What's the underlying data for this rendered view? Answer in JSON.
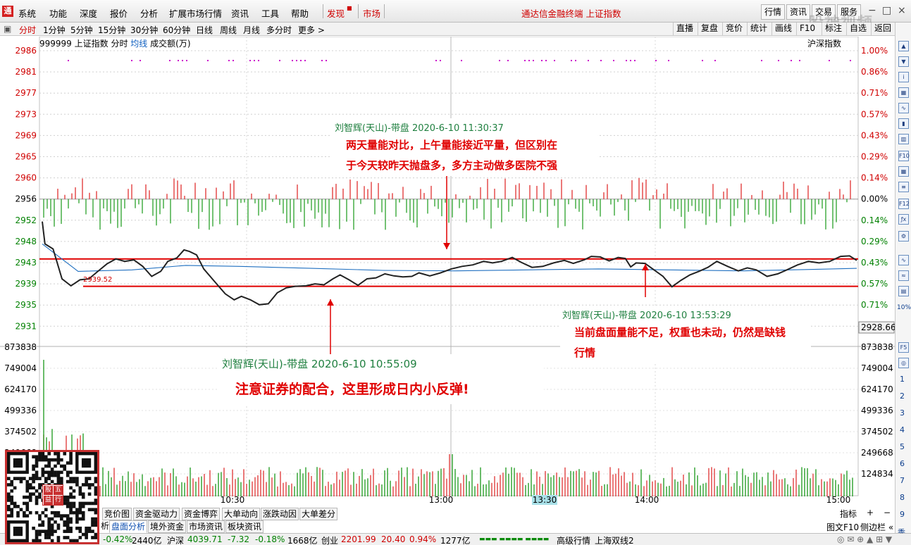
{
  "menubar": {
    "logo_glyph": "通",
    "items": [
      "系统",
      "功能",
      "深度",
      "报价",
      "分析",
      "扩展市场行情",
      "资讯",
      "工具",
      "帮助"
    ],
    "discover": "发现",
    "market": "市场",
    "title": "通达信金融终端 上证指数",
    "right_buttons": [
      "行情",
      "资讯",
      "交易",
      "服务"
    ],
    "window_controls": [
      "−",
      "□",
      "×"
    ]
  },
  "toolbar": {
    "periods": [
      "分时",
      "1分钟",
      "5分钟",
      "15分钟",
      "30分钟",
      "60分钟",
      "日线",
      "周线",
      "月线",
      "多分时",
      "更多 >"
    ],
    "active_period": "分时",
    "right": [
      "直播",
      "复盘",
      "竞价",
      "统计",
      "画线",
      "F10",
      "标注",
      "自选",
      "返回"
    ]
  },
  "chart_info": {
    "code": "999999 上证指数",
    "mode": "分时",
    "avg_line": "均线",
    "volume_label": "成交额(万)",
    "right_label": "沪深指数"
  },
  "watermark": "股神视频",
  "chart_data": {
    "type": "line",
    "title": "999999 上证指数 分时",
    "price_axis_left": [
      "2986",
      "2981",
      "2977",
      "2973",
      "2969",
      "2965",
      "2960",
      "2956",
      "2952",
      "2948",
      "2943",
      "2939",
      "2935",
      "2931"
    ],
    "pct_axis_right": [
      "1.00%",
      "0.86%",
      "0.71%",
      "0.57%",
      "0.43%",
      "0.29%",
      "0.14%",
      "0.00%",
      "0.14%",
      "0.29%",
      "0.43%",
      "0.57%",
      "0.71%",
      "0.86%"
    ],
    "prev_close": 2956,
    "current_price_label": "2928.66",
    "low_label": "2939.52",
    "volume_axis": [
      "873838",
      "749004",
      "624170",
      "499336",
      "374502",
      "249668",
      "124834"
    ],
    "time_labels": [
      "10:30",
      "13:00",
      "13:30",
      "14:00",
      "15:00"
    ],
    "highlighted_time": "13:30",
    "support_resistance": [
      2944,
      2938.5
    ],
    "price_path": [
      [
        0,
        2951.5
      ],
      [
        3,
        2947
      ],
      [
        12,
        2946
      ],
      [
        22,
        2940
      ],
      [
        32,
        2938.6
      ],
      [
        42,
        2939.8
      ],
      [
        52,
        2940
      ],
      [
        62,
        2941.5
      ],
      [
        72,
        2943
      ],
      [
        82,
        2944
      ],
      [
        92,
        2943.5
      ],
      [
        102,
        2943.8
      ],
      [
        112,
        2942.5
      ],
      [
        122,
        2940.5
      ],
      [
        132,
        2941.5
      ],
      [
        140,
        2943.5
      ],
      [
        150,
        2944.2
      ],
      [
        158,
        2945.8
      ],
      [
        164,
        2945.5
      ],
      [
        172,
        2944.8
      ],
      [
        180,
        2942
      ],
      [
        192,
        2939.5
      ],
      [
        204,
        2937
      ],
      [
        214,
        2935.8
      ],
      [
        222,
        2936.5
      ],
      [
        232,
        2935.8
      ],
      [
        242,
        2934.8
      ],
      [
        252,
        2935
      ],
      [
        262,
        2937.2
      ],
      [
        272,
        2938.2
      ],
      [
        282,
        2938.5
      ],
      [
        294,
        2938.6
      ],
      [
        304,
        2939
      ],
      [
        314,
        2938.8
      ],
      [
        324,
        2940
      ],
      [
        332,
        2940.8
      ],
      [
        342,
        2939.8
      ],
      [
        352,
        2938.7
      ],
      [
        362,
        2940
      ],
      [
        372,
        2940.2
      ],
      [
        382,
        2941
      ],
      [
        392,
        2940.6
      ],
      [
        402,
        2940.4
      ],
      [
        412,
        2940.5
      ],
      [
        420,
        2941.2
      ],
      [
        432,
        2940.6
      ],
      [
        444,
        2941.2
      ],
      [
        456,
        2942
      ],
      [
        468,
        2942.5
      ],
      [
        480,
        2942.8
      ],
      [
        492,
        2943.5
      ],
      [
        502,
        2943.2
      ],
      [
        512,
        2943.5
      ],
      [
        524,
        2944.3
      ],
      [
        534,
        2943.3
      ],
      [
        546,
        2942.3
      ],
      [
        558,
        2942.5
      ],
      [
        570,
        2943.2
      ],
      [
        582,
        2943.7
      ],
      [
        592,
        2943.1
      ],
      [
        604,
        2943.8
      ],
      [
        612,
        2944.5
      ],
      [
        622,
        2944.4
      ],
      [
        632,
        2943.6
      ],
      [
        642,
        2944.3
      ],
      [
        650,
        2944.1
      ],
      [
        656,
        2942.4
      ],
      [
        662,
        2943.2
      ],
      [
        672,
        2943.1
      ],
      [
        682,
        2941.8
      ],
      [
        692,
        2940.5
      ],
      [
        702,
        2938.4
      ],
      [
        712,
        2939.7
      ],
      [
        722,
        2940.8
      ],
      [
        732,
        2941.5
      ],
      [
        742,
        2942.3
      ],
      [
        752,
        2943.5
      ],
      [
        764,
        2942.5
      ],
      [
        776,
        2941.6
      ],
      [
        786,
        2942.2
      ],
      [
        796,
        2941.8
      ],
      [
        808,
        2940.5
      ],
      [
        820,
        2941
      ],
      [
        830,
        2941.8
      ],
      [
        842,
        2942.8
      ],
      [
        854,
        2943.5
      ],
      [
        866,
        2943.2
      ],
      [
        878,
        2943.5
      ],
      [
        890,
        2944.5
      ],
      [
        900,
        2944.6
      ],
      [
        908,
        2943.7
      ]
    ],
    "avg_path": [
      [
        0,
        2947
      ],
      [
        40,
        2941.5
      ],
      [
        100,
        2941.8
      ],
      [
        160,
        2942.7
      ],
      [
        220,
        2942.5
      ],
      [
        300,
        2942.1
      ],
      [
        380,
        2941.7
      ],
      [
        460,
        2941.6
      ],
      [
        540,
        2941.8
      ],
      [
        620,
        2942
      ],
      [
        700,
        2941.8
      ],
      [
        780,
        2941.6
      ],
      [
        860,
        2941.9
      ],
      [
        908,
        2942.1
      ]
    ]
  },
  "notes": [
    {
      "meta": "刘智辉(天山)-带盘 2020-6-10 11:30:37",
      "lines": [
        "两天量能对比，上午量能接近平量，但区别在",
        "于今天较昨天抛盘多，多方主动做多医院不强"
      ]
    },
    {
      "meta": "刘智辉(天山)-带盘 2020-6-10 10:55:09",
      "lines": [
        "注意证券的配合，这里形成日内小反弹!"
      ]
    },
    {
      "meta": "刘智辉(天山)-带盘 2020-6-10 13:53:29",
      "lines": [
        "当前盘面量能不足，权重也未动，仍然是缺钱",
        "行情"
      ]
    }
  ],
  "bottom_tabs_row1": [
    "竞价图",
    "资金驱动力",
    "资金博弈",
    "大单动向",
    "涨跌动因",
    "大单差分"
  ],
  "bottom_tabs_row2": [
    "析",
    "盘面分析",
    "境外资金",
    "市场资讯",
    "板块资讯"
  ],
  "bottom_right": [
    "指标",
    "+",
    "−"
  ],
  "bottom_right2": [
    "图文F10",
    "侧边栏 «"
  ],
  "qr_tiles": [
    "股",
    "五",
    "益",
    "行"
  ],
  "rightbar_numbers": [
    "1",
    "2",
    "3",
    "4",
    "5",
    "6",
    "7",
    "8",
    "9",
    "季"
  ],
  "rightbar_pct": "10%",
  "statusbar": {
    "sh_change_pct": "-0.42%",
    "sh_amount": "2440亿",
    "hs_label": "沪深",
    "hs_value": "4039.71",
    "hs_change": "-7.32",
    "hs_change_pct": "-0.18%",
    "hs_amount": "1668亿",
    "cy_label": "创业",
    "cy_value": "2201.99",
    "cy_change": "20.40",
    "cy_change_pct": "0.94%",
    "cy_amount": "1277亿",
    "feed": "高级行情_上海双线2"
  }
}
